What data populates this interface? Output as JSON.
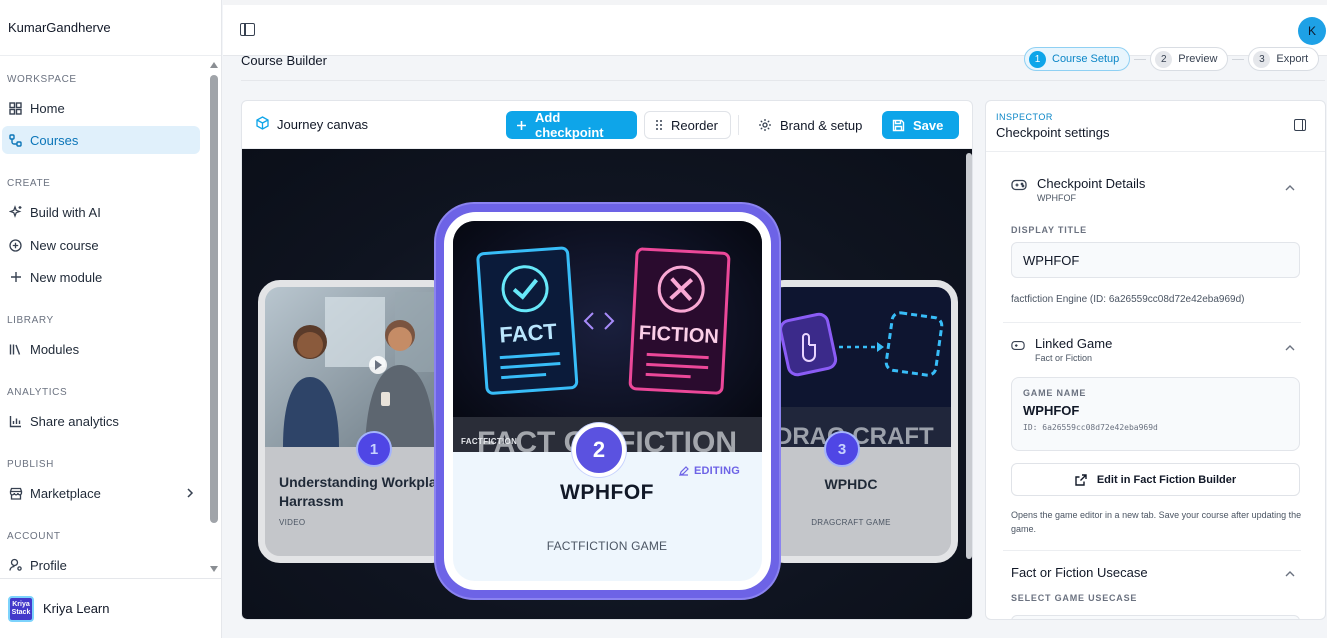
{
  "sidebar": {
    "user": "KumarGandherve",
    "sections": {
      "workspace": "WORKSPACE",
      "create": "CREATE",
      "library": "LIBRARY",
      "analytics": "ANALYTICS",
      "publish": "PUBLISH",
      "account": "ACCOUNT"
    },
    "items": {
      "home": "Home",
      "courses": "Courses",
      "build_ai": "Build with AI",
      "new_course": "New course",
      "new_module": "New module",
      "modules": "Modules",
      "share_analytics": "Share analytics",
      "marketplace": "Marketplace",
      "profile": "Profile"
    },
    "active_item": "Courses",
    "footer": {
      "org_name": "Kriya Learn",
      "logo_text_top": "Kriya",
      "logo_text_bottom": "Stack"
    }
  },
  "topbar": {
    "avatar_initial": "K"
  },
  "page": {
    "title": "Course Builder",
    "steps": [
      {
        "num": "1",
        "label": "Course Setup",
        "active": true
      },
      {
        "num": "2",
        "label": "Preview",
        "active": false
      },
      {
        "num": "3",
        "label": "Export",
        "active": false
      }
    ]
  },
  "canvas": {
    "title": "Journey canvas",
    "buttons": {
      "add_checkpoint": "Add checkpoint",
      "reorder": "Reorder",
      "brand_setup": "Brand & setup",
      "save": "Save"
    },
    "cards": {
      "left": {
        "num": "1",
        "title": "Understanding Workplace Harrassm",
        "type": "VIDEO"
      },
      "center": {
        "num": "2",
        "title": "WPHFOF",
        "type": "FACTFICTION GAME",
        "badge": "EDITING",
        "tag": "FACTFICTION",
        "art_fact": "FACT",
        "art_fiction": "FICTION",
        "art_banner": "FACT OR FICTION"
      },
      "right": {
        "num": "3",
        "title": "WPHDC",
        "type": "DRAGCRAFT GAME",
        "art_banner": "DRAG CRAFT"
      }
    }
  },
  "inspector": {
    "kicker": "INSPECTOR",
    "title": "Checkpoint settings",
    "details": {
      "title": "Checkpoint Details",
      "subtitle": "WPHFOF",
      "display_title_label": "DISPLAY TITLE",
      "display_title_value": "WPHFOF",
      "engine_text": "factfiction Engine (ID: 6a26559cc08d72e42eba969d)"
    },
    "linked_game": {
      "title": "Linked Game",
      "subtitle": "Fact or Fiction",
      "game_name_label": "GAME NAME",
      "game_name": "WPHFOF",
      "game_id": "ID: 6a26559cc08d72e42eba969d",
      "edit_button": "Edit in Fact Fiction Builder",
      "help": "Opens the game editor in a new tab. Save your course after updating the game."
    },
    "usecase": {
      "title": "Fact or Fiction Usecase",
      "select_label": "SELECT GAME USECASE"
    }
  }
}
